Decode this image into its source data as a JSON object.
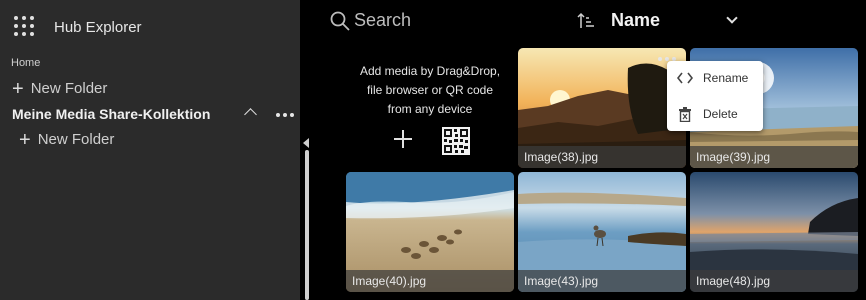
{
  "sidebar": {
    "title": "Hub Explorer",
    "breadcrumb": "Home",
    "new_folder_label": "New Folder",
    "collection_name": "Meine Media Share-Kollektion",
    "sub_new_folder_label": "New Folder"
  },
  "toolbar": {
    "search_label": "Search",
    "sort_label": "Name"
  },
  "add_media": {
    "text": "Add media by Drag&Drop,\nfile browser or QR code\nfrom any device"
  },
  "items": [
    {
      "name": "Image(38).jpg"
    },
    {
      "name": "Image(39).jpg"
    },
    {
      "name": "Image(40).jpg"
    },
    {
      "name": "Image(43).jpg"
    },
    {
      "name": "Image(48).jpg"
    }
  ],
  "context_menu": {
    "rename_label": "Rename",
    "delete_label": "Delete"
  },
  "icons": [
    "apps-grid-icon",
    "plus-icon",
    "chevron-up-icon",
    "more-icon",
    "search-icon",
    "sort-icon",
    "chevron-down-icon",
    "qr-code-icon",
    "code-icon",
    "trash-icon"
  ]
}
